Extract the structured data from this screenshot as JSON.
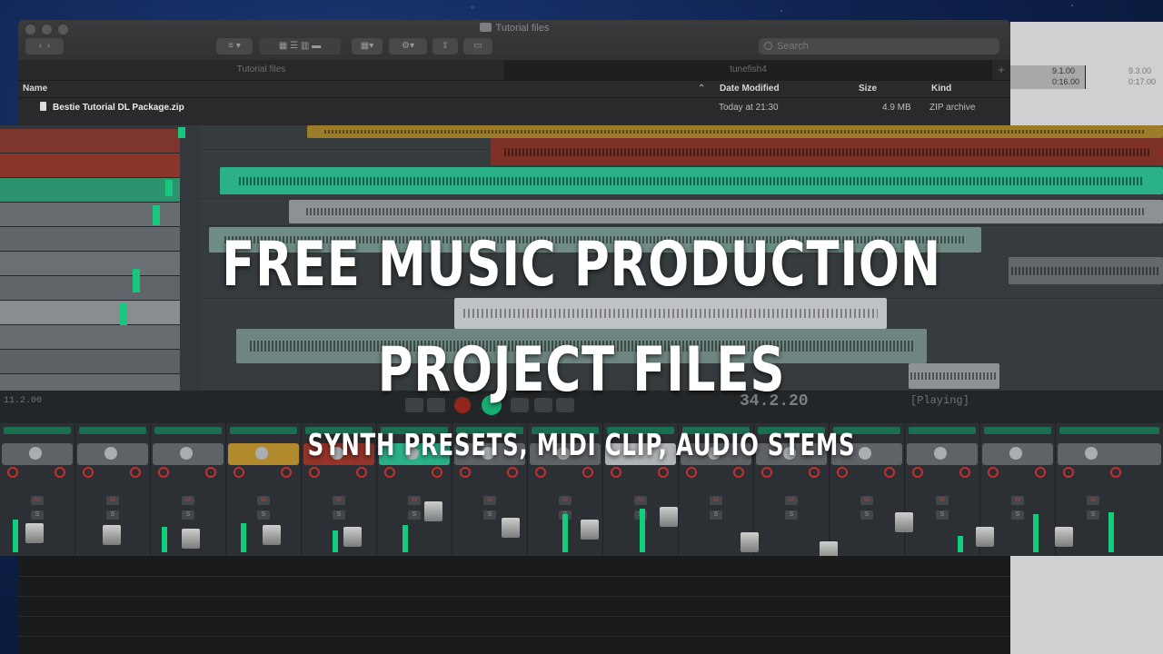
{
  "finder": {
    "window_title": "Tutorial files",
    "search_placeholder": "Search",
    "tabs": [
      "Tutorial files",
      "tunefish4"
    ],
    "columns": {
      "name": "Name",
      "date_modified": "Date Modified",
      "size": "Size",
      "kind": "Kind"
    },
    "files": [
      {
        "name": "Bestie Tutorial DL Package.zip",
        "date_modified": "Today at 21:30",
        "size": "4.9 MB",
        "kind": "ZIP archive"
      }
    ]
  },
  "background_window": {
    "ruler_top": "9.1.00",
    "ruler_bottom": "0:16.00",
    "ruler_top_faded": "9.3.00",
    "ruler_bottom_faded": "0:17.00"
  },
  "daw": {
    "position_left": "11.2.00",
    "position_main": "34.2.20",
    "status": "[Playing]"
  },
  "overlay": {
    "line1": "FREE MUSIC PRODUCTION",
    "line2": "PROJECT FILES",
    "subtitle": "SYNTH PRESETS, MIDI CLIP, AUDIO STEMS"
  },
  "colors": {
    "accent_green": "#19e08c",
    "clip_teal": "#2fc79a",
    "clip_gold": "#c9a032",
    "clip_red": "#b23a2a"
  }
}
